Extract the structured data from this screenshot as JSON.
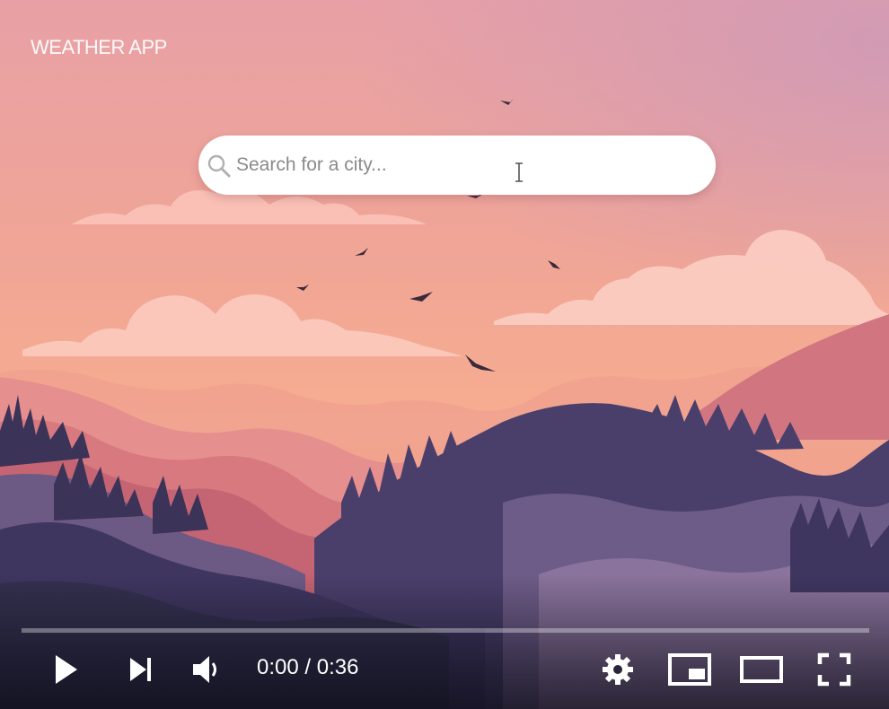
{
  "app": {
    "title": "WEATHER APP"
  },
  "search": {
    "placeholder": "Search for a city...",
    "value": ""
  },
  "player": {
    "current_time": "0:00",
    "separator": " / ",
    "duration": "0:36",
    "progress": 0.0,
    "controls": {
      "play": "play-icon",
      "next": "next-icon",
      "volume": "volume-icon",
      "settings": "gear-icon",
      "miniplayer": "miniplayer-icon",
      "theater": "theater-mode-icon",
      "fullscreen": "fullscreen-icon"
    }
  },
  "colors": {
    "sky_top": "#e6a3a8",
    "sky_mid": "#f3a78f",
    "mountain_dark": "#4a3f6b",
    "mountain_mid": "#6c5a85",
    "mountain_pink": "#c86d7a",
    "progress_played": "#ff0000"
  }
}
